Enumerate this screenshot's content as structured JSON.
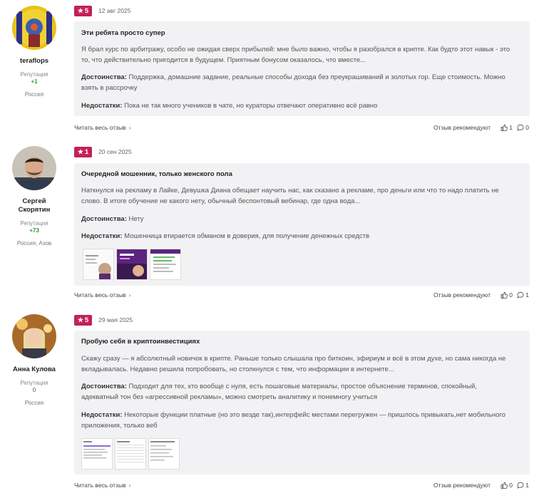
{
  "reviews": [
    {
      "author": "teraflops",
      "reputation_label": "Репутация",
      "reputation": "+1",
      "location": "Россия",
      "rating": "5",
      "date": "12 авг 2025",
      "title": "Эти ребята просто супер",
      "text": "Я брал курс по арбитражу, особо не ожидая сверх прибылей: мне было важно, чтобы я разобрался в крипте. Как будто этот навык - это то, что действительно пригодится в будущем. Приятным бонусом оказалось, что вместе...",
      "pros_label": "Достоинства:",
      "pros": "Поддержка, домашние задание, реальные способы дохода без преукрашиваний и золотых гор. Еще стоимость. Можно взять в рассрочку",
      "cons_label": "Недостатки:",
      "cons": "Пока не так много учеников в чате, но кураторы отвечают оперативно всё равно",
      "read_more": "Читать весь отзыв",
      "recommend": "Отзыв рекомендуют",
      "likes": "1",
      "comments": "0"
    },
    {
      "author": "Сергей Скорятин",
      "reputation_label": "Репутация",
      "reputation": "+73",
      "location": "Россия, Азов",
      "rating": "1",
      "date": "20 сен 2025",
      "title": "Очередной мошенник, только женского пола",
      "text": "Наткнулся на рекламу в Лайке, Девушка Диана обещает научить нас, как сказано а рекламе, про деньги или что то надо платить не слово. В итоге обучение не какого нету, обычный беспонтовый вебинар, где одна вода...",
      "pros_label": "Достоинства:",
      "pros": "Нету",
      "cons_label": "Недостатки:",
      "cons": "Мошенница втирается обманом в доверия, для получение денежных средств",
      "read_more": "Читать весь отзыв",
      "recommend": "Отзыв рекомендуют",
      "likes": "0",
      "comments": "1"
    },
    {
      "author": "Анна Кулова",
      "reputation_label": "Репутация",
      "reputation": "0",
      "location": "Россия",
      "rating": "5",
      "date": "29 мая 2025",
      "title": "Пробую себя в криптоинвестициях",
      "text": "Скажу сразу — я абсолютный новичок в крипте. Раньше только слышала про биткоин, эфириум и всё в этом духе, но сама никогда не вкладывалась. Недавно решила попробовать, но столкнулся с тем, что информации в интернете...",
      "pros_label": "Достоинства:",
      "pros": "Подходит для тех, кто вообще с нуля, есть пошаговые материалы, простое объяснение терминов, спокойный, адекватный тон без «агрессивной рекламы», можно смотреть аналитику и понемногу учиться",
      "cons_label": "Недостатки:",
      "cons": "Некоторые функции платные (но это везде так),интерфейс местами перегружен — пришлось привыкать,нет мобильного приложения, только веб",
      "read_more": "Читать весь отзыв",
      "recommend": "Отзыв рекомендуют",
      "likes": "0",
      "comments": "1"
    }
  ],
  "icons": {
    "star": "star-icon",
    "like": "thumbs-up-icon",
    "comment": "comment-bubble-icon",
    "chevron": "chevron-right-icon"
  },
  "colors": {
    "rating_badge": "#c4205a",
    "reputation_positive": "#2e9b3a",
    "review_box": "#f2f2f4"
  }
}
